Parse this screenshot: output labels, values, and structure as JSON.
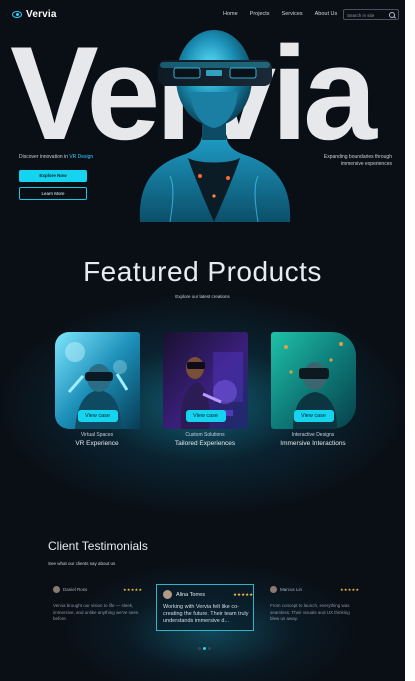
{
  "brand": {
    "name": "Vervia",
    "accent": "#15d4f0"
  },
  "nav": {
    "links": [
      "Home",
      "Projects",
      "Services",
      "About Us"
    ],
    "search_placeholder": "Search in site"
  },
  "hero": {
    "big_word": "Vervia",
    "tagline_prefix": "Discover innovation in ",
    "tagline_accent": "VR Design",
    "primary_button": "Explore Now",
    "secondary_button": "Learn More",
    "right_text": "Expanding boundaries through immersive experiences"
  },
  "featured": {
    "title": "Featured Products",
    "subtitle": "Explore our latest creations",
    "cards": [
      {
        "button": "View case",
        "subtitle": "Virtual Spaces",
        "title": "VR Experience"
      },
      {
        "button": "View case",
        "subtitle": "Custom Solutions",
        "title": "Tailored Experiences"
      },
      {
        "button": "View case",
        "subtitle": "Interactive Designs",
        "title": "Immersive Interactions"
      }
    ]
  },
  "testimonials": {
    "title": "Client Testimonials",
    "subtitle": "See what our clients say about us",
    "items": [
      {
        "name": "Daniel Ross",
        "stars": "★★★★★",
        "quote": "Vervia brought our vision to life — sleek, immersive, and unlike anything we've seen before."
      },
      {
        "name": "Alina Torres",
        "stars": "★★★★★",
        "quote": "Working with Vervia felt like co-creating the future. Their team truly understands immersive d..."
      },
      {
        "name": "Marcus Lin",
        "stars": "★★★★★",
        "quote": "From concept to launch, everything was seamless. Their visuals and UX thinking blew us away."
      }
    ],
    "active_dot": 1
  }
}
